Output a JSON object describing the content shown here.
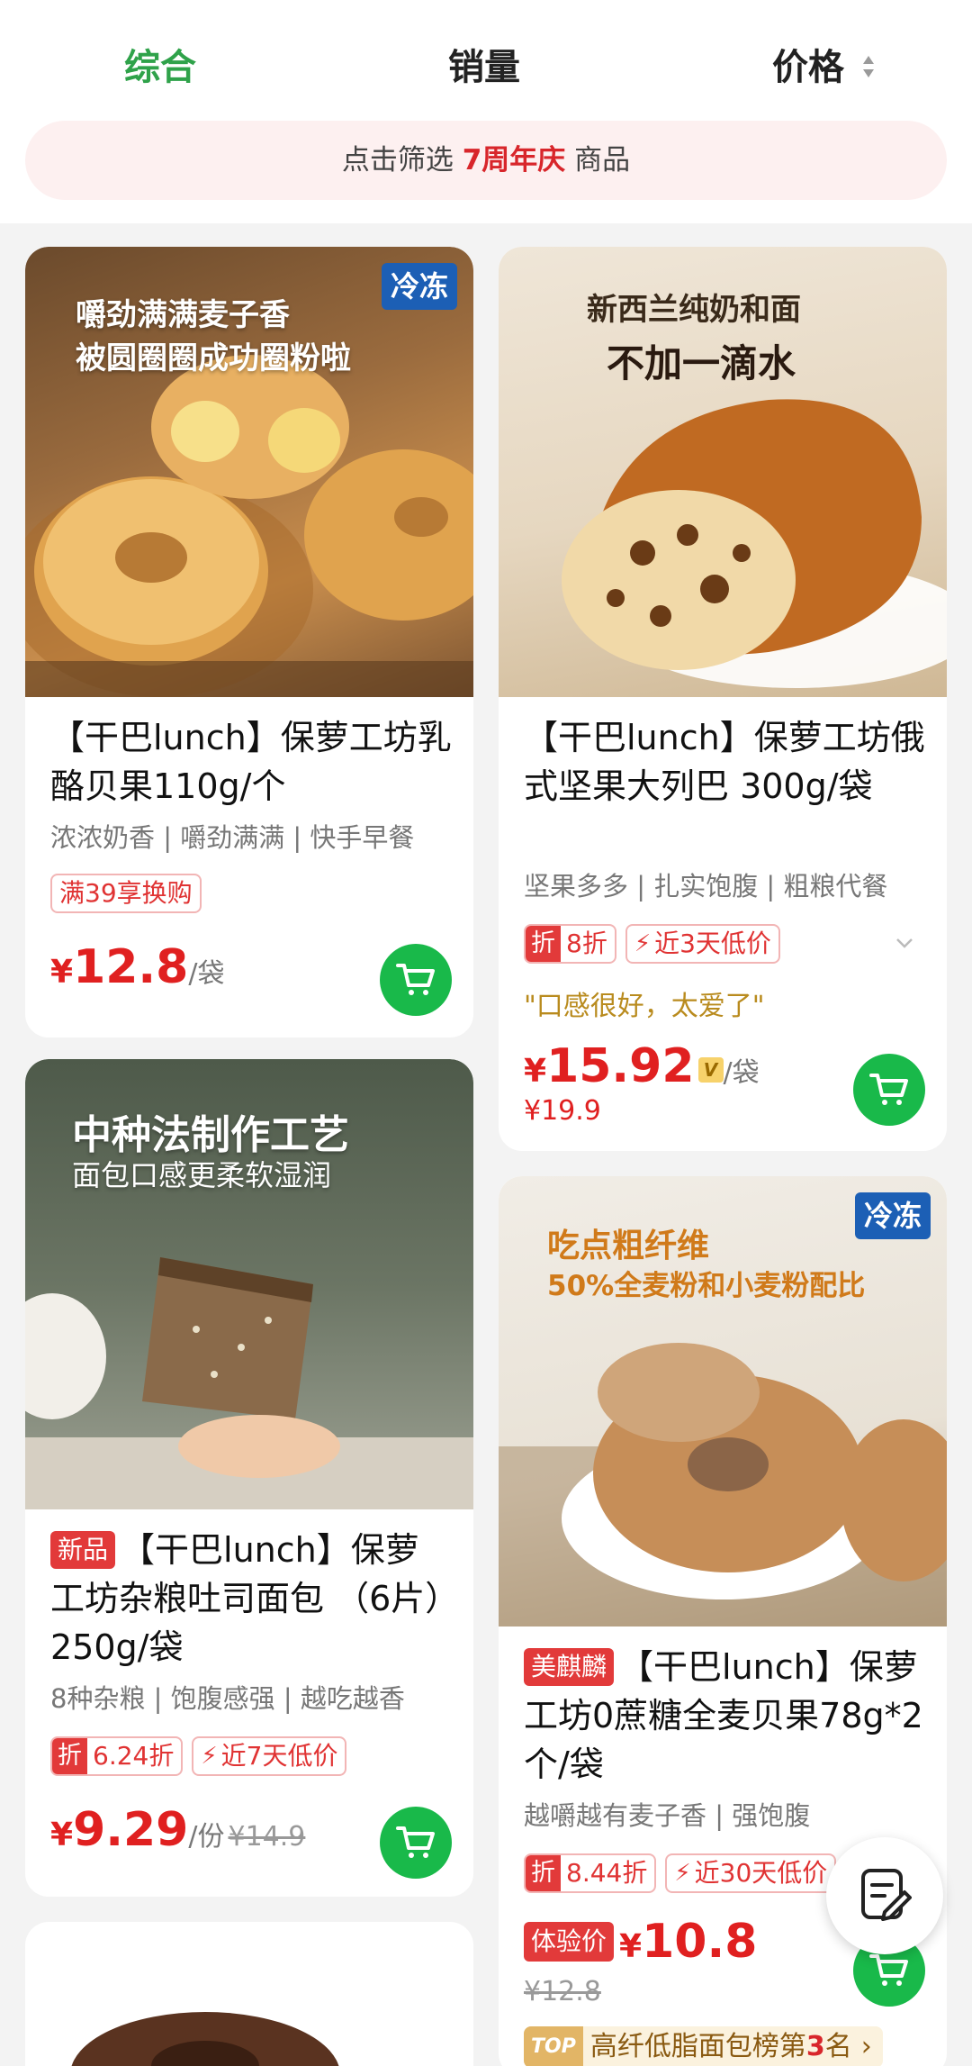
{
  "sort_bar": {
    "tabs": [
      "综合",
      "销量",
      "价格"
    ],
    "active": "综合",
    "filter_prefix": "点击筛选",
    "filter_highlight": "7周年庆",
    "filter_suffix": "商品"
  },
  "colors": {
    "accent_green": "#2fa24a",
    "price_red": "#e02020",
    "cart_green": "#19b94a",
    "cold_blue": "#1c5fb5"
  },
  "products": [
    {
      "image_caption_1": "嚼劲满满麦子香",
      "image_caption_2": "被圆圈圈成功圈粉啦",
      "badge": "冷冻",
      "title": "【干巴lunch】保萝工坊乳酪贝果110g/个",
      "subtitle": "浓浓奶香 | 嚼劲满满 | 快手早餐",
      "promo": "满39享换购",
      "price_yen": "¥",
      "price": "12.8",
      "unit": "/袋"
    },
    {
      "image_caption_1": "新西兰纯奶和面",
      "image_caption_2": "不加一滴水",
      "title": "【干巴lunch】保萝工坊俄式坚果大列巴 300g/袋",
      "subtitle": "坚果多多 | 扎实饱腹 | 粗粮代餐",
      "discount_label": "折",
      "discount": "8折",
      "low_price": "近3天低价",
      "quote": "\"口感很好，太爱了\"",
      "price_yen": "¥",
      "price": "15.92",
      "vip": "V",
      "unit": "/袋",
      "original_price": "¥19.9"
    },
    {
      "image_caption_1": "中种法制作工艺",
      "image_caption_2": "面包口感更柔软湿润",
      "new_tag": "新品",
      "title": "【干巴lunch】保萝工坊杂粮吐司面包 （6片）250g/袋",
      "subtitle": "8种杂粮 | 饱腹感强 | 越吃越香",
      "discount_label": "折",
      "discount": "6.24折",
      "low_price": "近7天低价",
      "price_yen": "¥",
      "price": "9.29",
      "unit": "/份",
      "original_price": "¥14.9"
    },
    {
      "image_caption_1": "吃点粗纤维",
      "image_caption_2": "50%全麦粉和小麦粉配比",
      "badge": "冷冻",
      "brand_tag": "美麒麟",
      "title": "【干巴lunch】保萝工坊0蔗糖全麦贝果78g*2个/袋",
      "subtitle": "越嚼越有麦子香 | 强饱腹",
      "discount_label": "折",
      "discount": "8.44折",
      "low_price": "近30天低价",
      "trial_tag": "体验价",
      "price_yen": "¥",
      "price": "10.8",
      "original_price": "¥12.8",
      "rank_top": "TOP",
      "rank_text": "高纤低脂面包榜第",
      "rank_num": "3",
      "rank_suffix": "名"
    }
  ]
}
